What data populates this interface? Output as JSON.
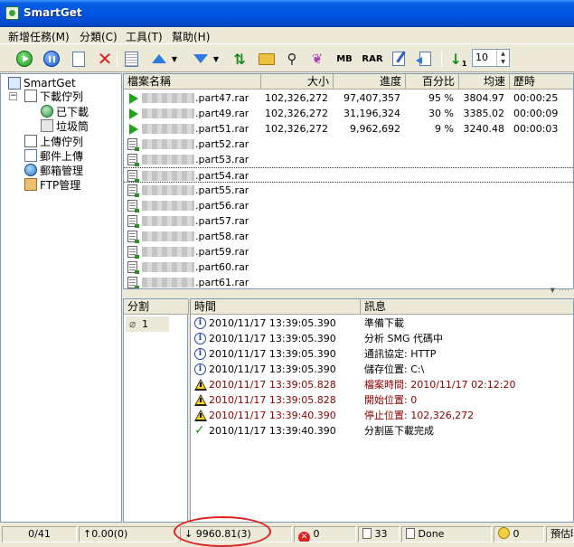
{
  "title": "SmartGet",
  "menu": [
    "新增任務(M)",
    "分類(C)",
    "工具(T)",
    "幫助(H)"
  ],
  "toolbar": {
    "mb_label": "MB",
    "rar_label": "RAR",
    "thread_count": "10"
  },
  "tree": {
    "root": "SmartGet",
    "items": [
      "下載佇列",
      "已下載",
      "垃圾筒",
      "上傳佇列",
      "郵件上傳",
      "郵箱管理",
      "FTP管理"
    ]
  },
  "list": {
    "headers": [
      "檔案名稱",
      "大小",
      "進度",
      "百分比",
      "均速",
      "歷時"
    ],
    "rows": [
      {
        "name": ".part47.rar",
        "size": "102,326,272",
        "progress": "97,407,357",
        "pct": "95 %",
        "speed": "3804.97",
        "time": "00:00:25",
        "active": true
      },
      {
        "name": ".part49.rar",
        "size": "102,326,272",
        "progress": "31,196,324",
        "pct": "30 %",
        "speed": "3385.02",
        "time": "00:00:09",
        "active": true
      },
      {
        "name": ".part51.rar",
        "size": "102,326,272",
        "progress": "9,962,692",
        "pct": "9 %",
        "speed": "3240.48",
        "time": "00:00:03",
        "active": true
      },
      {
        "name": ".part52.rar",
        "size": "",
        "progress": "",
        "pct": "",
        "speed": "",
        "time": "",
        "active": false
      },
      {
        "name": ".part53.rar",
        "size": "",
        "progress": "",
        "pct": "",
        "speed": "",
        "time": "",
        "active": false
      },
      {
        "name": ".part54.rar",
        "size": "",
        "progress": "",
        "pct": "",
        "speed": "",
        "time": "",
        "active": false
      },
      {
        "name": ".part55.rar",
        "size": "",
        "progress": "",
        "pct": "",
        "speed": "",
        "time": "",
        "active": false
      },
      {
        "name": ".part56.rar",
        "size": "",
        "progress": "",
        "pct": "",
        "speed": "",
        "time": "",
        "active": false
      },
      {
        "name": ".part57.rar",
        "size": "",
        "progress": "",
        "pct": "",
        "speed": "",
        "time": "",
        "active": false
      },
      {
        "name": ".part58.rar",
        "size": "",
        "progress": "",
        "pct": "",
        "speed": "",
        "time": "",
        "active": false
      },
      {
        "name": ".part59.rar",
        "size": "",
        "progress": "",
        "pct": "",
        "speed": "",
        "time": "",
        "active": false
      },
      {
        "name": ".part60.rar",
        "size": "",
        "progress": "",
        "pct": "",
        "speed": "",
        "time": "",
        "active": false
      },
      {
        "name": ".part61.rar",
        "size": "",
        "progress": "",
        "pct": "",
        "speed": "",
        "time": "",
        "active": false
      }
    ]
  },
  "segments": {
    "header": "分割",
    "items": [
      "1"
    ]
  },
  "log": {
    "headers": [
      "時間",
      "訊息"
    ],
    "rows": [
      {
        "type": "info",
        "time": "2010/11/17 13:39:05.390",
        "msg": "準備下載"
      },
      {
        "type": "info",
        "time": "2010/11/17 13:39:05.390",
        "msg": "分析 SMG 代碼中"
      },
      {
        "type": "info",
        "time": "2010/11/17 13:39:05.390",
        "msg": "通訊協定: HTTP"
      },
      {
        "type": "info",
        "time": "2010/11/17 13:39:05.390",
        "msg": "儲存位置: C:\\"
      },
      {
        "type": "warn",
        "time": "2010/11/17 13:39:05.828",
        "msg": "檔案時間: 2010/11/17 02:12:20"
      },
      {
        "type": "warn",
        "time": "2010/11/17 13:39:05.828",
        "msg": "開始位置: 0"
      },
      {
        "type": "warn",
        "time": "2010/11/17 13:39:40.390",
        "msg": "停止位置: 102,326,272"
      },
      {
        "type": "ok",
        "time": "2010/11/17 13:39:40.390",
        "msg": "分割區下載完成"
      }
    ]
  },
  "status": {
    "count": "0/41",
    "upload": "↑0.00(0)",
    "download": "↓  9960.81(3)",
    "errors": "0",
    "items": "33",
    "done": "Done",
    "scheduled": "0",
    "forecast": "預估時"
  }
}
